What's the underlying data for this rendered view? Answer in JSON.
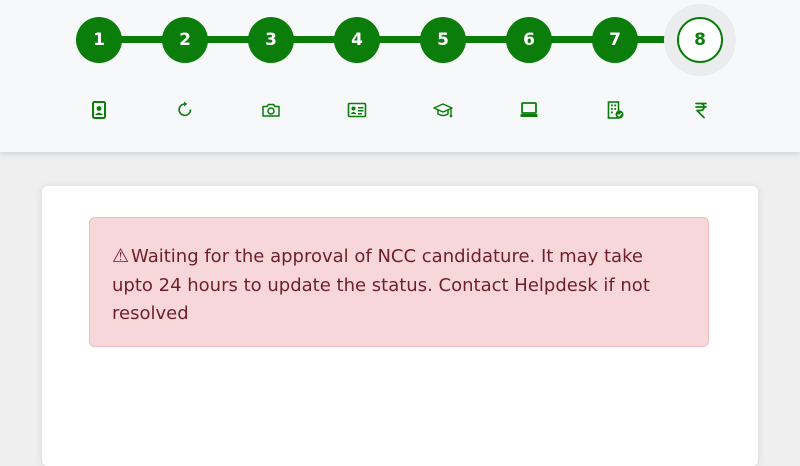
{
  "steps": [
    {
      "label": "1",
      "icon": "id-card-portrait-icon"
    },
    {
      "label": "2",
      "icon": "refresh-icon"
    },
    {
      "label": "3",
      "icon": "camera-icon"
    },
    {
      "label": "4",
      "icon": "id-card-icon"
    },
    {
      "label": "5",
      "icon": "graduation-cap-icon"
    },
    {
      "label": "6",
      "icon": "laptop-icon"
    },
    {
      "label": "7",
      "icon": "building-check-icon"
    },
    {
      "label": "8",
      "icon": "rupee-icon"
    }
  ],
  "current_step": "8",
  "alert": {
    "icon": "warning-icon",
    "message": "Waiting for the approval of NCC candidature. It may take upto 24 hours to update the status. Contact Helpdesk if not resolved"
  },
  "colors": {
    "accent": "#0a7d0a",
    "alert_bg": "#f8d7da",
    "alert_text": "#6f1f27"
  }
}
